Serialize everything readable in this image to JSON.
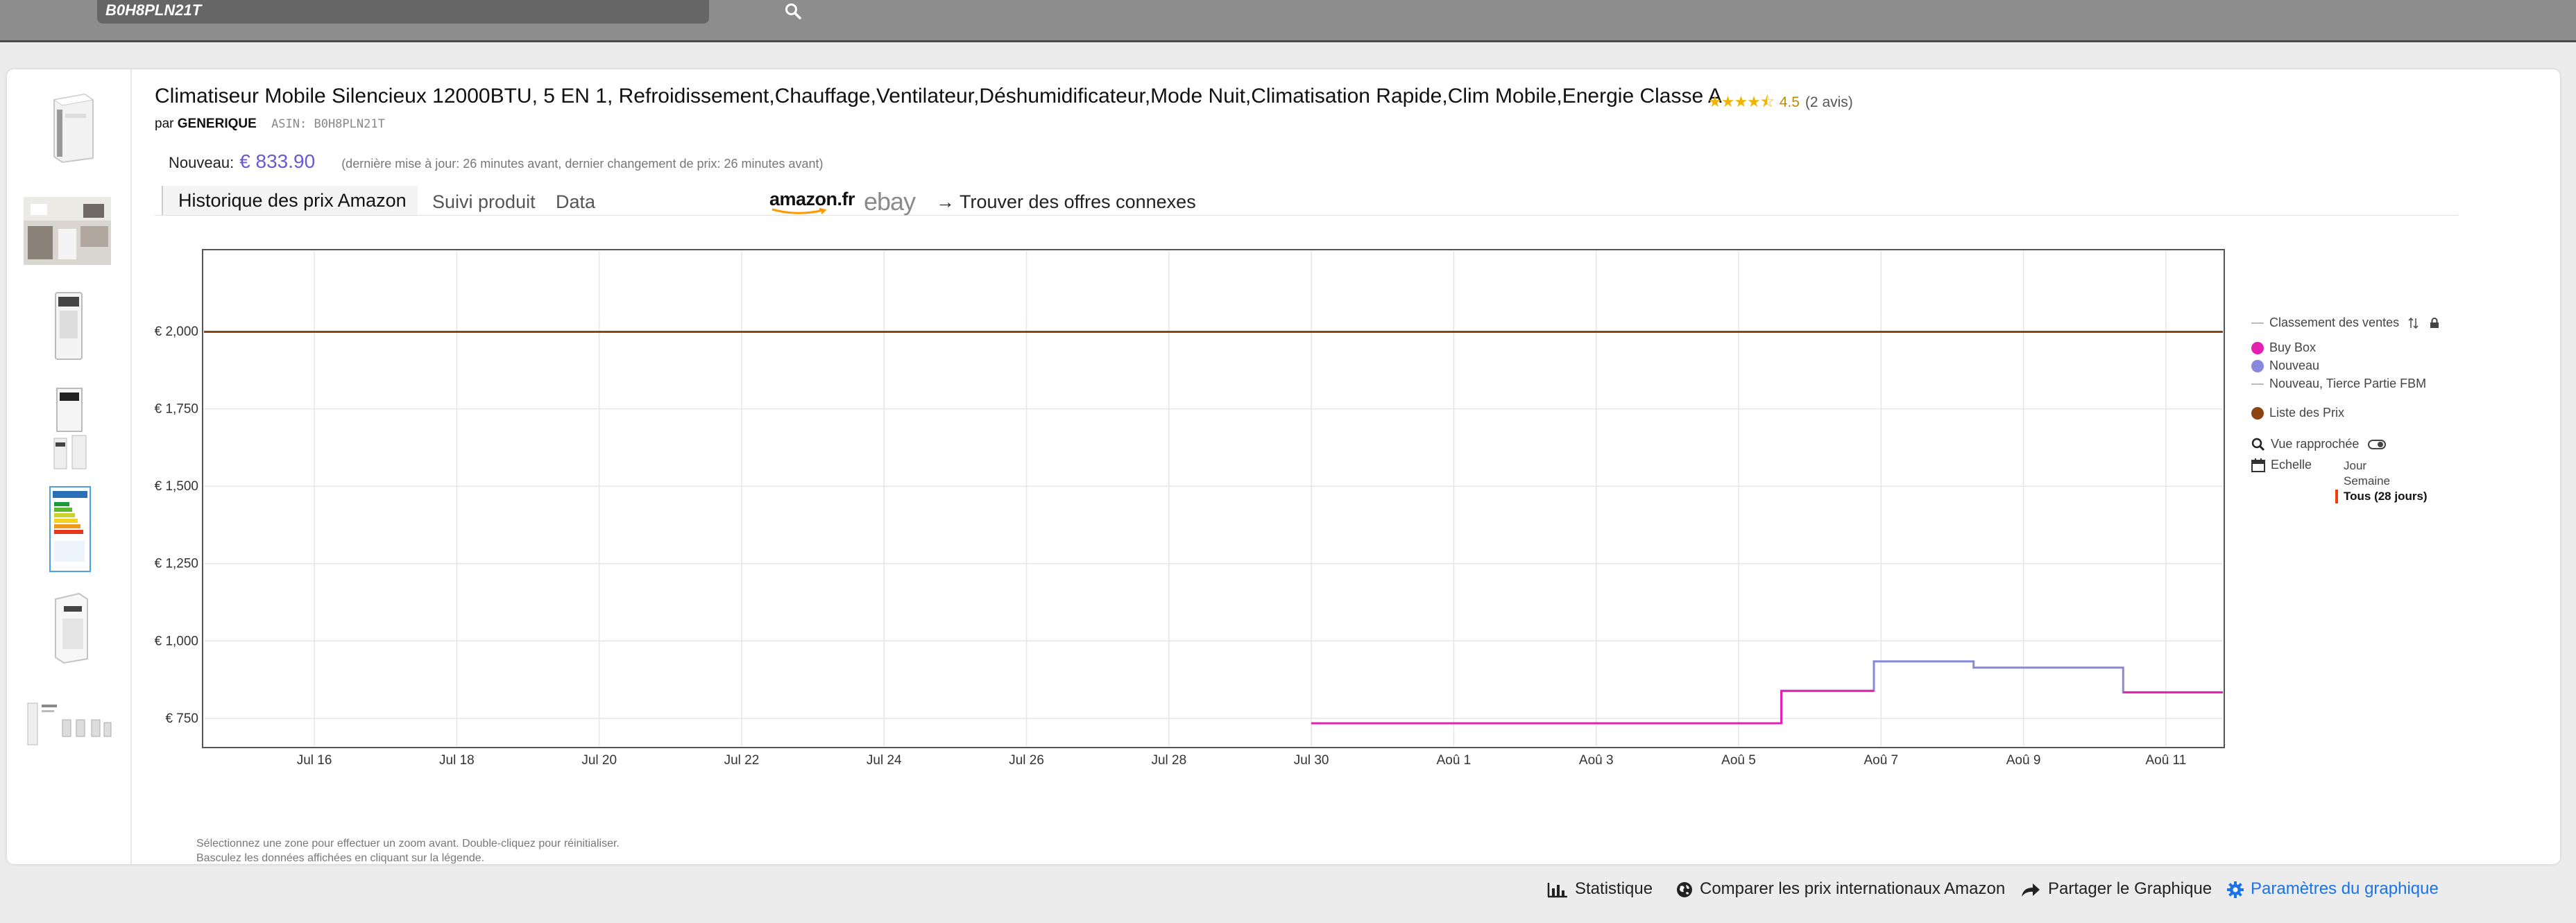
{
  "search": {
    "value": "B0H8PLN21T",
    "placeholder": ""
  },
  "product": {
    "title": "Climatiseur Mobile Silencieux 12000BTU, 5 EN 1, Refroidissement,Chauffage,Ventilateur,Déshumidificateur,Mode Nuit,Climatisation Rapide,Clim Mobile,Energie Classe A",
    "stars": "★★★★⯪",
    "rating": "4.5",
    "reviews": "(2 avis)",
    "by_prefix": "par",
    "brand": "GENERIQUE",
    "asin": "ASIN: B0H8PLN21T",
    "price_label": "Nouveau:",
    "price": "€ 833.90",
    "price_note": "(dernière mise à jour: 26 minutes avant,  dernier changement de prix: 26 minutes avant)"
  },
  "tabs": {
    "history": "Historique des prix Amazon",
    "tracking": "Suivi produit",
    "data": "Data",
    "amazon_logo": "amazon.fr",
    "ebay_logo": "ebay",
    "offers": "→  Trouver des offres connexes"
  },
  "chart_hint": [
    "Sélectionnez une zone pour effectuer un zoom avant. Double-cliquez pour réinitialiser.",
    "Basculez les données affichées en cliquant sur la légende."
  ],
  "legend": {
    "sales_rank": "Classement des ventes",
    "buy_box": "Buy Box",
    "new": "Nouveau",
    "new_fbm": "Nouveau, Tierce Partie FBM",
    "list_price": "Liste des Prix",
    "zoom": "Vue rapprochée",
    "scale": "Echelle",
    "scale_options": [
      "Jour",
      "Semaine",
      "Tous (28 jours)"
    ],
    "scale_selected": "Tous (28 jours)"
  },
  "actions": {
    "stats": "Statistique",
    "compare": "Comparer les prix internationaux Amazon",
    "share": "Partager le Graphique",
    "settings": "Paramètres du graphique"
  },
  "colors": {
    "buy_box": "#e61fb4",
    "new": "#8888dd",
    "list_price": "#8b4513",
    "accent": "#1a73e8"
  },
  "chart_data": {
    "type": "line",
    "y_ticks": [
      "€ 750",
      "€ 1,000",
      "€ 1,250",
      "€ 1,500",
      "€ 1,750",
      "€ 2,000"
    ],
    "y_tick_values": [
      750,
      1000,
      1250,
      1500,
      1750,
      2000
    ],
    "ylim": [
      660,
      2260
    ],
    "x_ticks": [
      "Jul 16",
      "Jul 18",
      "Jul 20",
      "Jul 22",
      "Jul 24",
      "Jul 26",
      "Jul 28",
      "Jul 30",
      "Aoû 1",
      "Aoû 3",
      "Aoû 5",
      "Aoû 7",
      "Aoû 9",
      "Aoû 11"
    ],
    "x_tick_days": [
      0,
      2,
      4,
      6,
      8,
      10,
      12,
      14,
      16,
      18,
      20,
      22,
      24,
      26
    ],
    "xlim": [
      -1.55,
      26.8
    ],
    "grid": true,
    "legend_position": "right",
    "series": [
      {
        "name": "Liste des Prix",
        "color": "#8b4513",
        "x": [
          -1.55,
          26.8
        ],
        "y": [
          1999,
          1999
        ]
      },
      {
        "name": "Nouveau",
        "color": "#8888dd",
        "x": [
          14.0,
          20.6,
          20.6,
          21.9,
          21.9,
          23.3,
          23.3,
          25.4,
          25.4,
          26.8
        ],
        "y": [
          733.9,
          733.9,
          838.9,
          838.9,
          933.9,
          933.9,
          913.9,
          913.9,
          833.9,
          833.9
        ]
      },
      {
        "name": "Buy Box",
        "color": "#e61fb4",
        "x": [
          14.0,
          20.6,
          20.6,
          21.9,
          21.9,
          25.4,
          25.4,
          26.8
        ],
        "y": [
          733.9,
          733.9,
          838.9,
          838.9,
          null,
          null,
          833.9,
          833.9
        ]
      }
    ]
  }
}
